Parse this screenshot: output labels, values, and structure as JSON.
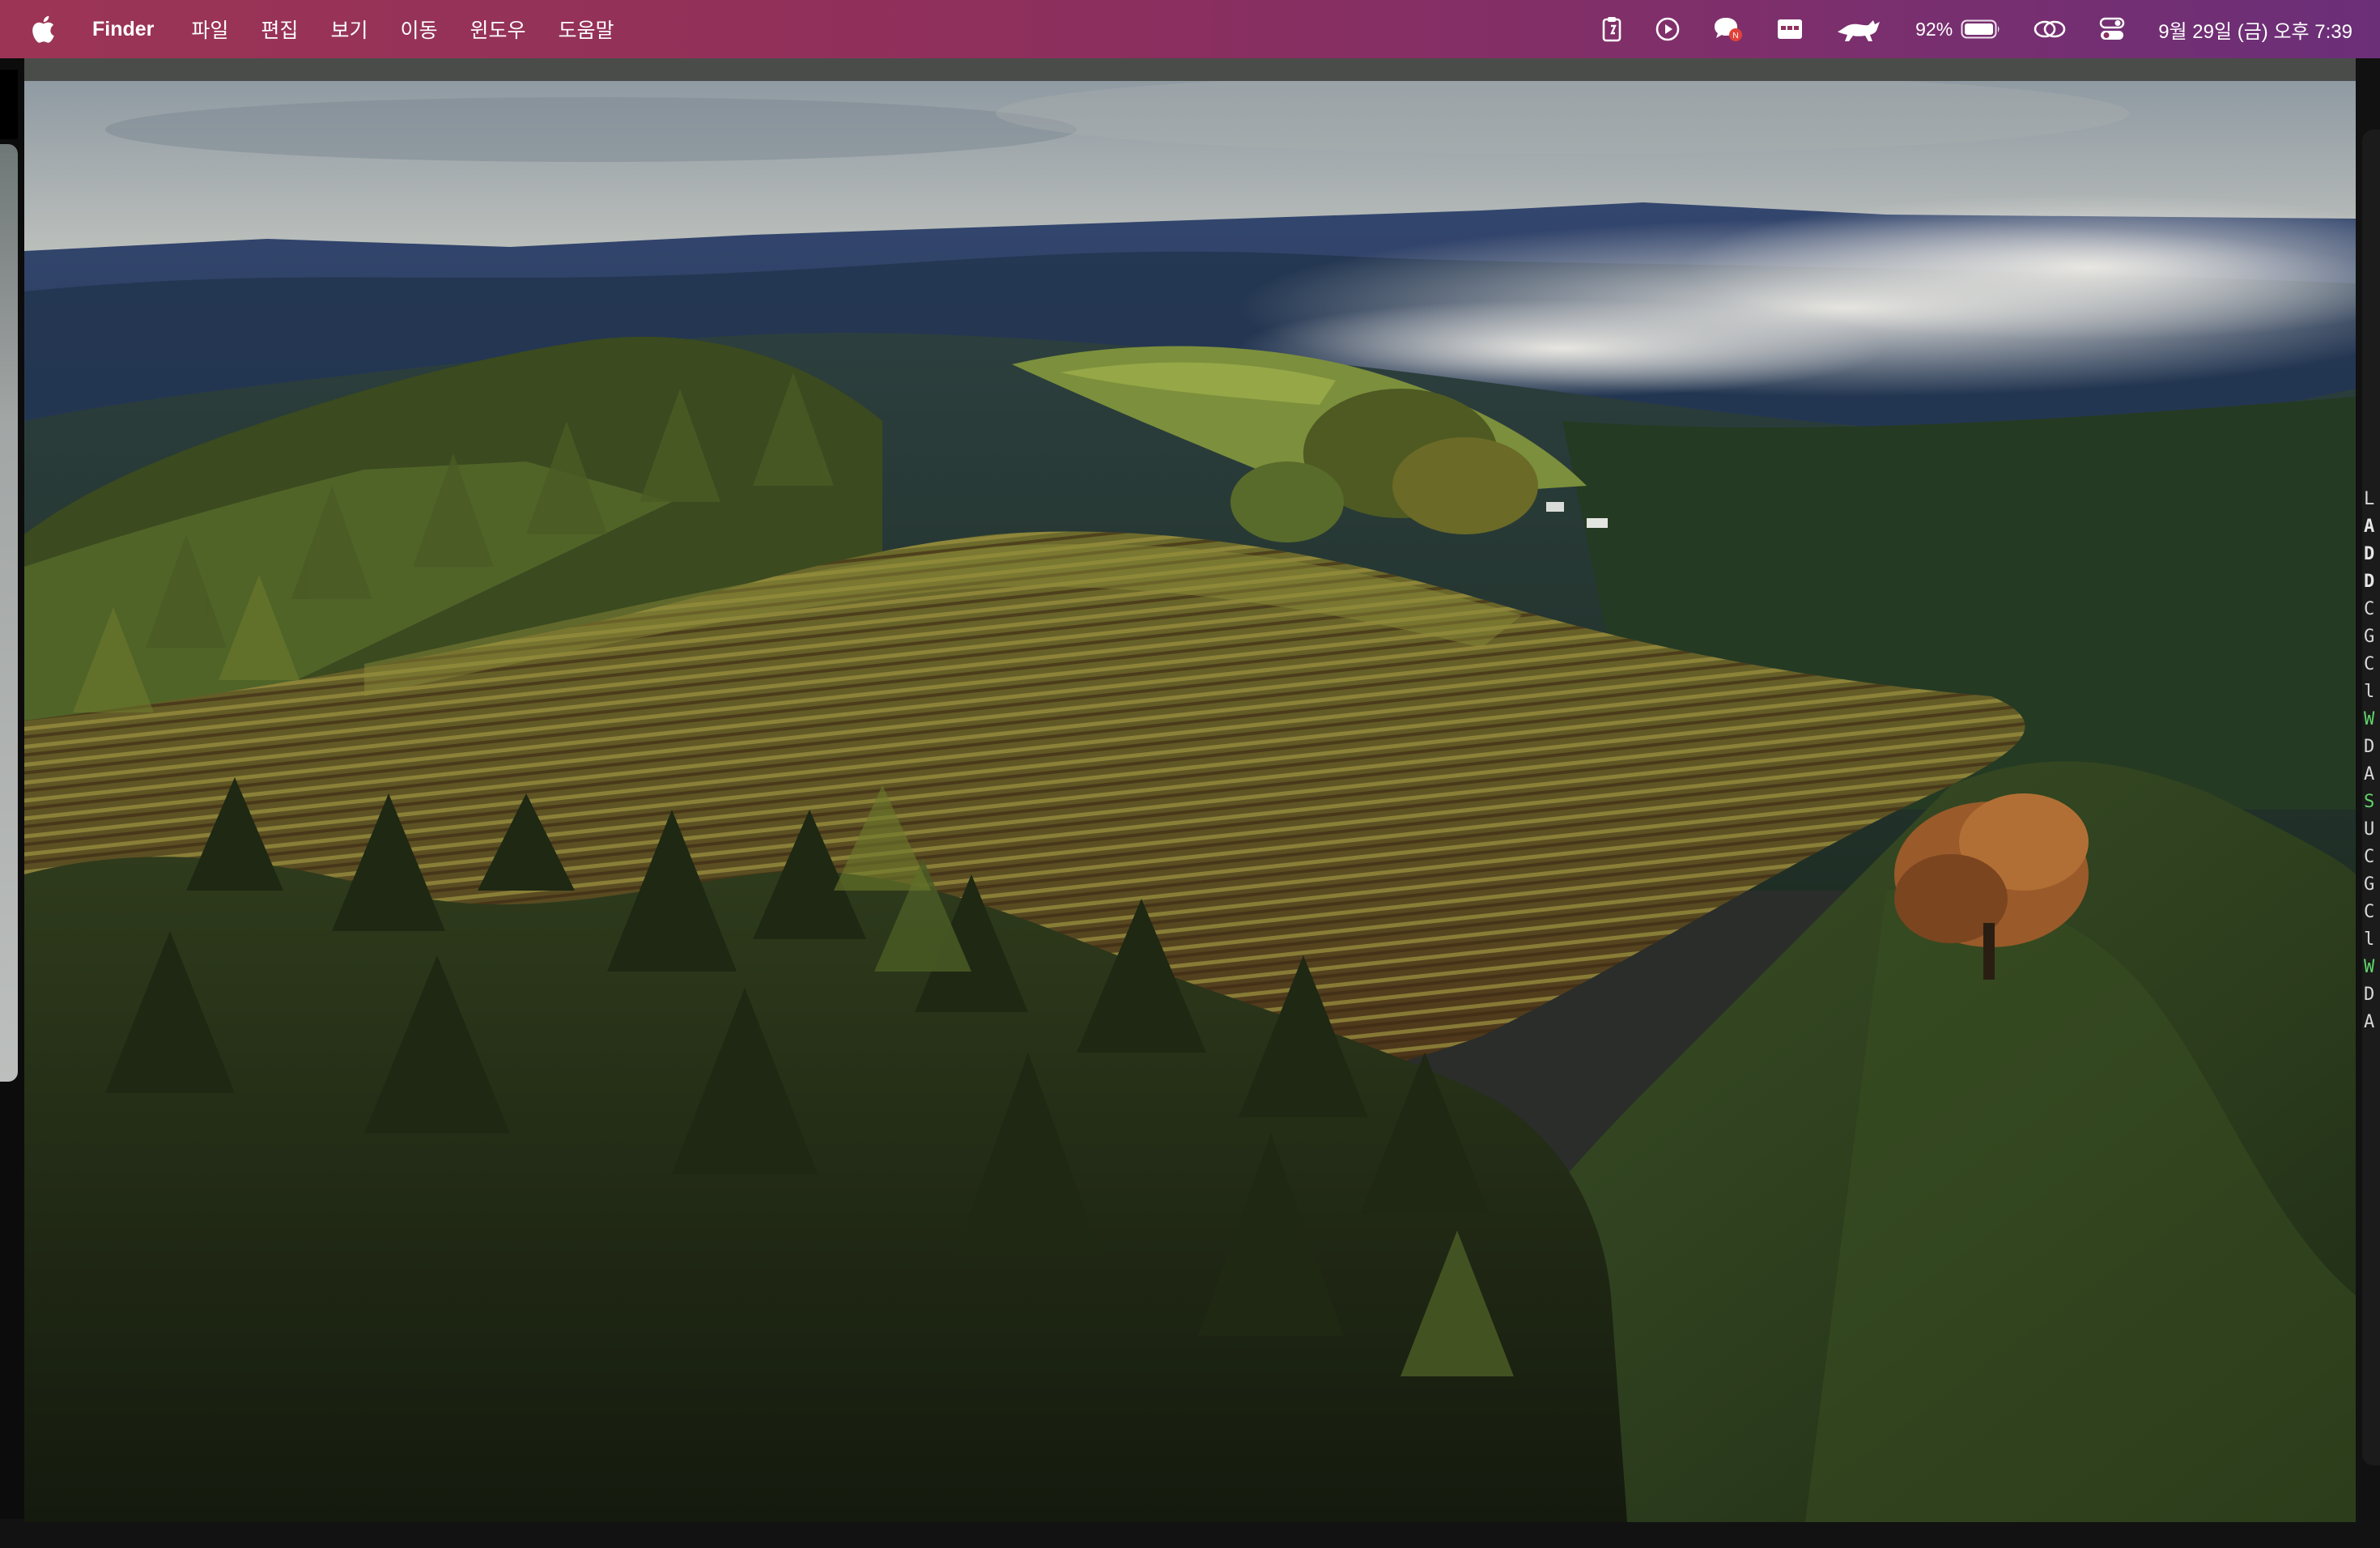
{
  "menubar": {
    "apple_icon": "apple-logo-icon",
    "app_name": "Finder",
    "menus": [
      "파일",
      "편집",
      "보기",
      "이동",
      "윈도우",
      "도움말"
    ],
    "status": {
      "battery_percent": "92%",
      "datetime": "9월 29일 (금) 오후 7:39",
      "icons": [
        "clipboard-icon",
        "play-circle-icon",
        "chat-notification-icon",
        "window-switcher-icon",
        "runcat-icon",
        "battery-icon",
        "link-icon",
        "control-center-icon"
      ]
    },
    "colors": {
      "start": "#9c3555",
      "end": "#6b2f78"
    }
  },
  "wallpaper": {
    "subject": "vineyard-hills-landscape"
  },
  "right_strip_chars": [
    "L",
    "A",
    "D",
    "D",
    "C",
    "G",
    "C",
    "l",
    "W",
    "D",
    "A",
    "S",
    "U",
    "C",
    "G",
    "C",
    "l",
    "W",
    "D",
    "A"
  ]
}
